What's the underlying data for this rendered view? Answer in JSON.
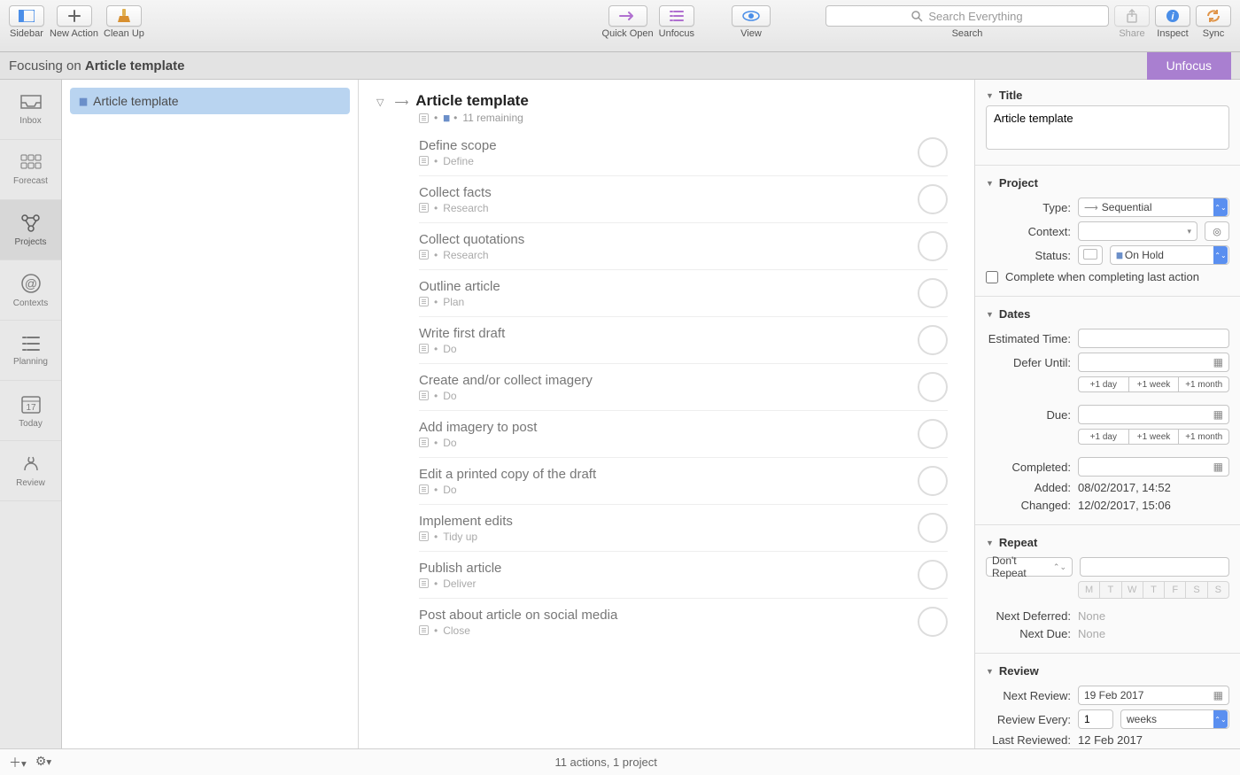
{
  "toolbar": {
    "sidebar": "Sidebar",
    "new_action": "New Action",
    "clean_up": "Clean Up",
    "quick_open": "Quick Open",
    "unfocus": "Unfocus",
    "view": "View",
    "search_label": "Search",
    "search_placeholder": "Search Everything",
    "share": "Share",
    "inspect": "Inspect",
    "sync": "Sync"
  },
  "focus_bar": {
    "prefix": "Focusing on ",
    "subject": "Article template",
    "unfocus_btn": "Unfocus"
  },
  "sidetabs": [
    "Inbox",
    "Forecast",
    "Projects",
    "Contexts",
    "Planning",
    "Today",
    "Review"
  ],
  "sidetabs_active_index": 2,
  "today_number": "17",
  "project_list": {
    "items": [
      {
        "name": "Article template",
        "selected": true
      }
    ]
  },
  "project": {
    "title": "Article template",
    "remaining": "11 remaining",
    "tasks": [
      {
        "title": "Define scope",
        "context": "Define"
      },
      {
        "title": "Collect facts",
        "context": "Research"
      },
      {
        "title": "Collect quotations",
        "context": "Research"
      },
      {
        "title": "Outline article",
        "context": "Plan"
      },
      {
        "title": "Write first draft",
        "context": "Do"
      },
      {
        "title": "Create and/or collect imagery",
        "context": "Do"
      },
      {
        "title": "Add imagery to post",
        "context": "Do"
      },
      {
        "title": "Edit a printed copy of the draft",
        "context": "Do"
      },
      {
        "title": "Implement edits",
        "context": "Tidy up"
      },
      {
        "title": "Publish article",
        "context": "Deliver"
      },
      {
        "title": "Post about article on social media",
        "context": "Close"
      }
    ]
  },
  "status_bar": "11 actions, 1 project",
  "inspector": {
    "title_section": "Title",
    "title_value": "Article template",
    "project_section": "Project",
    "type_label": "Type:",
    "type_value": "Sequential",
    "context_label": "Context:",
    "context_value": "",
    "status_label": "Status:",
    "status_value": "On Hold",
    "complete_when": "Complete when completing last action",
    "dates_section": "Dates",
    "est_label": "Estimated Time:",
    "defer_label": "Defer Until:",
    "due_label": "Due:",
    "completed_label": "Completed:",
    "added_label": "Added:",
    "added_value": "08/02/2017, 14:52",
    "changed_label": "Changed:",
    "changed_value": "12/02/2017, 15:06",
    "plus1day": "+1 day",
    "plus1week": "+1 week",
    "plus1month": "+1 month",
    "repeat_section": "Repeat",
    "repeat_mode": "Don't Repeat",
    "days": [
      "M",
      "T",
      "W",
      "T",
      "F",
      "S",
      "S"
    ],
    "next_deferred_label": "Next Deferred:",
    "next_due_label": "Next Due:",
    "none": "None",
    "review_section": "Review",
    "next_review_label": "Next Review:",
    "next_review_value": "19 Feb 2017",
    "review_every_label": "Review Every:",
    "review_every_num": "1",
    "review_every_unit": "weeks",
    "last_reviewed_label": "Last Reviewed:",
    "last_reviewed_value": "12 Feb 2017"
  }
}
